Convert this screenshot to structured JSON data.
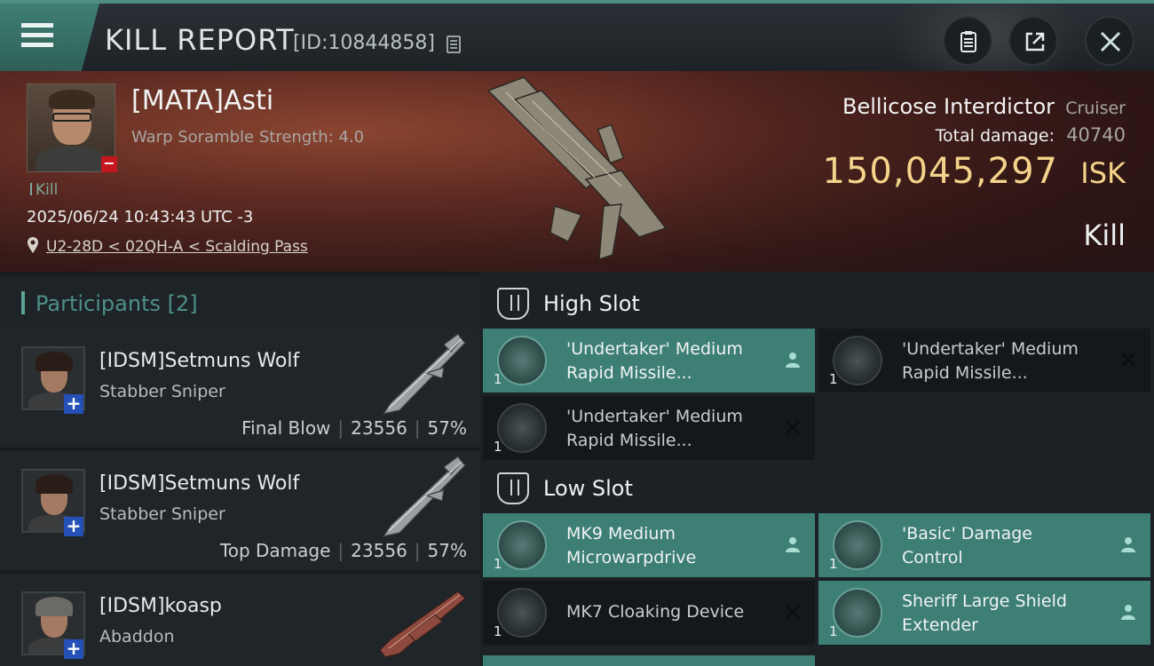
{
  "header": {
    "title": "KILL REPORT",
    "report_id": "[ID:10844858]"
  },
  "victim": {
    "name": "[MATA]Asti",
    "scramble": "Warp Soramble Strength: 4.0",
    "tag": "Kill",
    "datetime": "2025/06/24 10:43:43 UTC -3",
    "location": "U2-28D < 02QH-A < Scalding Pass",
    "ship_name": "Bellicose Interdictor",
    "ship_class": "Cruiser",
    "damage_label": "Total damage:",
    "damage_value": "40740",
    "isk_value": "150,045,297",
    "isk_unit": "ISK",
    "result": "Kill"
  },
  "participants": {
    "title": "Participants",
    "count": "[2]",
    "rows": [
      {
        "name": "[IDSM]Setmuns Wolf",
        "ship": "Stabber Sniper",
        "role": "Final Blow",
        "damage": "23556",
        "percent": "57%"
      },
      {
        "name": "[IDSM]Setmuns Wolf",
        "ship": "Stabber Sniper",
        "role": "Top Damage",
        "damage": "23556",
        "percent": "57%"
      },
      {
        "name": "[IDSM]koasp",
        "ship": "Abaddon"
      }
    ]
  },
  "fitting": {
    "high_slot": {
      "title": "High Slot",
      "modules": [
        {
          "line1": "'Undertaker' Medium",
          "line2": "Rapid Missile...",
          "qty": "1",
          "state": "fitted-person"
        },
        {
          "line1": "'Undertaker' Medium",
          "line2": "Rapid Missile...",
          "qty": "1",
          "state": "destroyed"
        },
        {
          "line1": "'Undertaker' Medium",
          "line2": "Rapid Missile...",
          "qty": "1",
          "state": "destroyed"
        }
      ]
    },
    "low_slot": {
      "title": "Low Slot",
      "modules": [
        {
          "line1": "MK9 Medium",
          "line2": "Microwarpdrive",
          "qty": "1",
          "state": "fitted-person"
        },
        {
          "line1": "'Basic' Damage",
          "line2": "Control",
          "qty": "1",
          "state": "fitted-person"
        },
        {
          "line1": "MK7 Cloaking Device",
          "qty": "1",
          "state": "destroyed"
        },
        {
          "line1": "Sheriff Large Shield",
          "line2": "Extender",
          "qty": "1",
          "state": "fitted-person"
        }
      ]
    }
  },
  "colors": {
    "accent": "#3d7f74",
    "isk": "#f4d38a",
    "badge_minus": "#c3171d",
    "badge_plus": "#2450b8"
  }
}
